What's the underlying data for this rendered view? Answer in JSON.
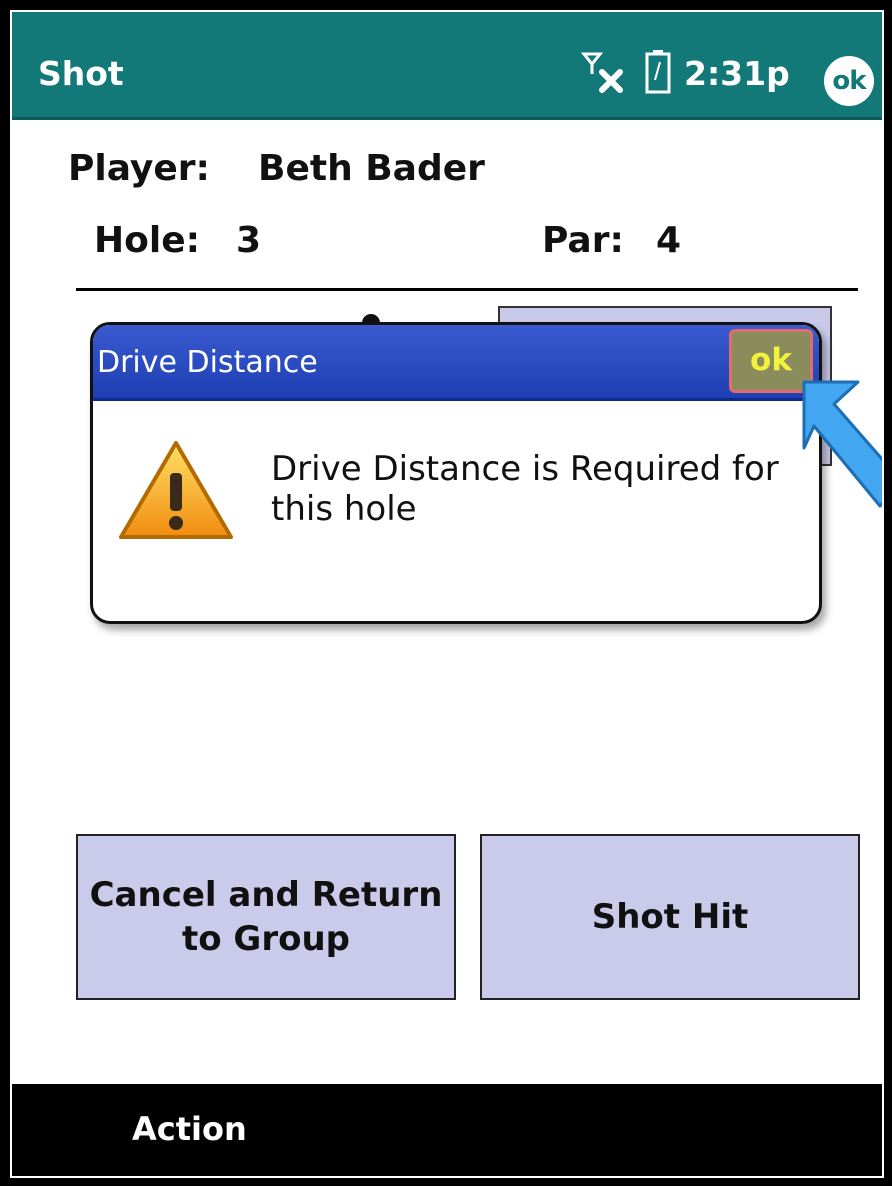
{
  "titlebar": {
    "title": "Shot",
    "time": "2:31p",
    "ok_label": "ok"
  },
  "details": {
    "player_label": "Player:",
    "player_name": "Beth Bader",
    "hole_label": "Hole:",
    "hole_value": "3",
    "par_label": "Par:",
    "par_value": "4"
  },
  "dialog": {
    "title": "Drive Distance",
    "ok_label": "ok",
    "message": "Drive Distance is Required for this hole"
  },
  "buttons": {
    "cancel": "Cancel and Return to Group",
    "shot_hit": "Shot Hit"
  },
  "menu": {
    "action": "Action"
  },
  "colors": {
    "titlebar": "#127978",
    "dialog_header": "#1e3fb3",
    "button_fill": "#cacaeb",
    "highlight": "#e06c6c",
    "pointer_arrow": "#43a6f0"
  }
}
